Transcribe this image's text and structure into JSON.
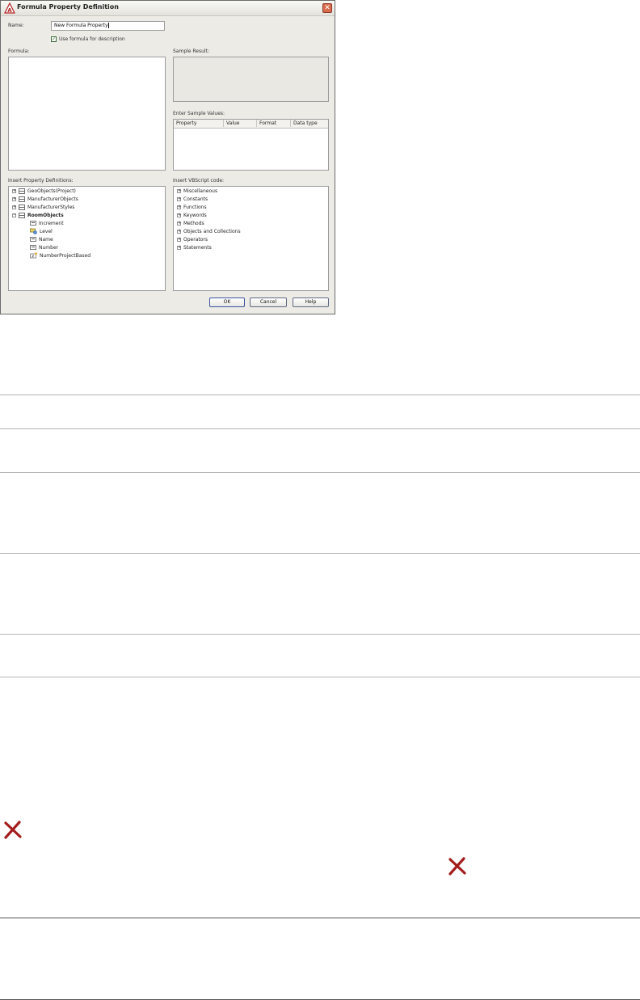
{
  "dialog": {
    "title": "Formula Property Definition",
    "name_label": "Name:",
    "name_value": "New Formula Property",
    "use_formula_checkbox": {
      "label": "Use formula for description",
      "checked": true
    },
    "formula_label": "Formula:",
    "sample_result_label": "Sample Result:",
    "enter_sample_values_label": "Enter Sample Values:",
    "sample_values_columns": [
      "Property",
      "Value",
      "Format",
      "Data type"
    ],
    "insert_property_definitions_label": "Insert Property Definitions:",
    "property_tree": [
      {
        "label": "GeoObjects(Project)",
        "expander": "+",
        "icon": "table-icon",
        "level": 0,
        "bold": false
      },
      {
        "label": "ManufacturerObjects",
        "expander": "+",
        "icon": "table-icon",
        "level": 0,
        "bold": false
      },
      {
        "label": "ManufacturerStyles",
        "expander": "+",
        "icon": "table-icon",
        "level": 0,
        "bold": false
      },
      {
        "label": "RoomObjects",
        "expander": "−",
        "icon": "table-icon",
        "level": 0,
        "bold": true
      },
      {
        "label": "Increment",
        "expander": "",
        "icon": "property-icon",
        "level": 1,
        "bold": false
      },
      {
        "label": "Level",
        "expander": "",
        "icon": "level-icon",
        "level": 1,
        "bold": false
      },
      {
        "label": "Name",
        "expander": "",
        "icon": "property-icon",
        "level": 1,
        "bold": false
      },
      {
        "label": "Number",
        "expander": "",
        "icon": "property-icon",
        "level": 1,
        "bold": false
      },
      {
        "label": "NumberProjectBased",
        "expander": "",
        "icon": "project-number-icon",
        "level": 1,
        "bold": false
      }
    ],
    "insert_vbscript_label": "Insert VBScript code:",
    "vbscript_tree": [
      "Miscellaneous",
      "Constants",
      "Functions",
      "Keywords",
      "Methods",
      "Objects and Collections",
      "Operators",
      "Statements"
    ],
    "buttons": {
      "ok": "OK",
      "cancel": "Cancel",
      "help": "Help"
    }
  },
  "page_icons": [
    "delete-x-icon",
    "delete-x-icon"
  ],
  "colors": {
    "dialog_bg": "#ecebe6",
    "x_icon": "#a31d1d",
    "checkbox_check": "#1f6b1f"
  }
}
